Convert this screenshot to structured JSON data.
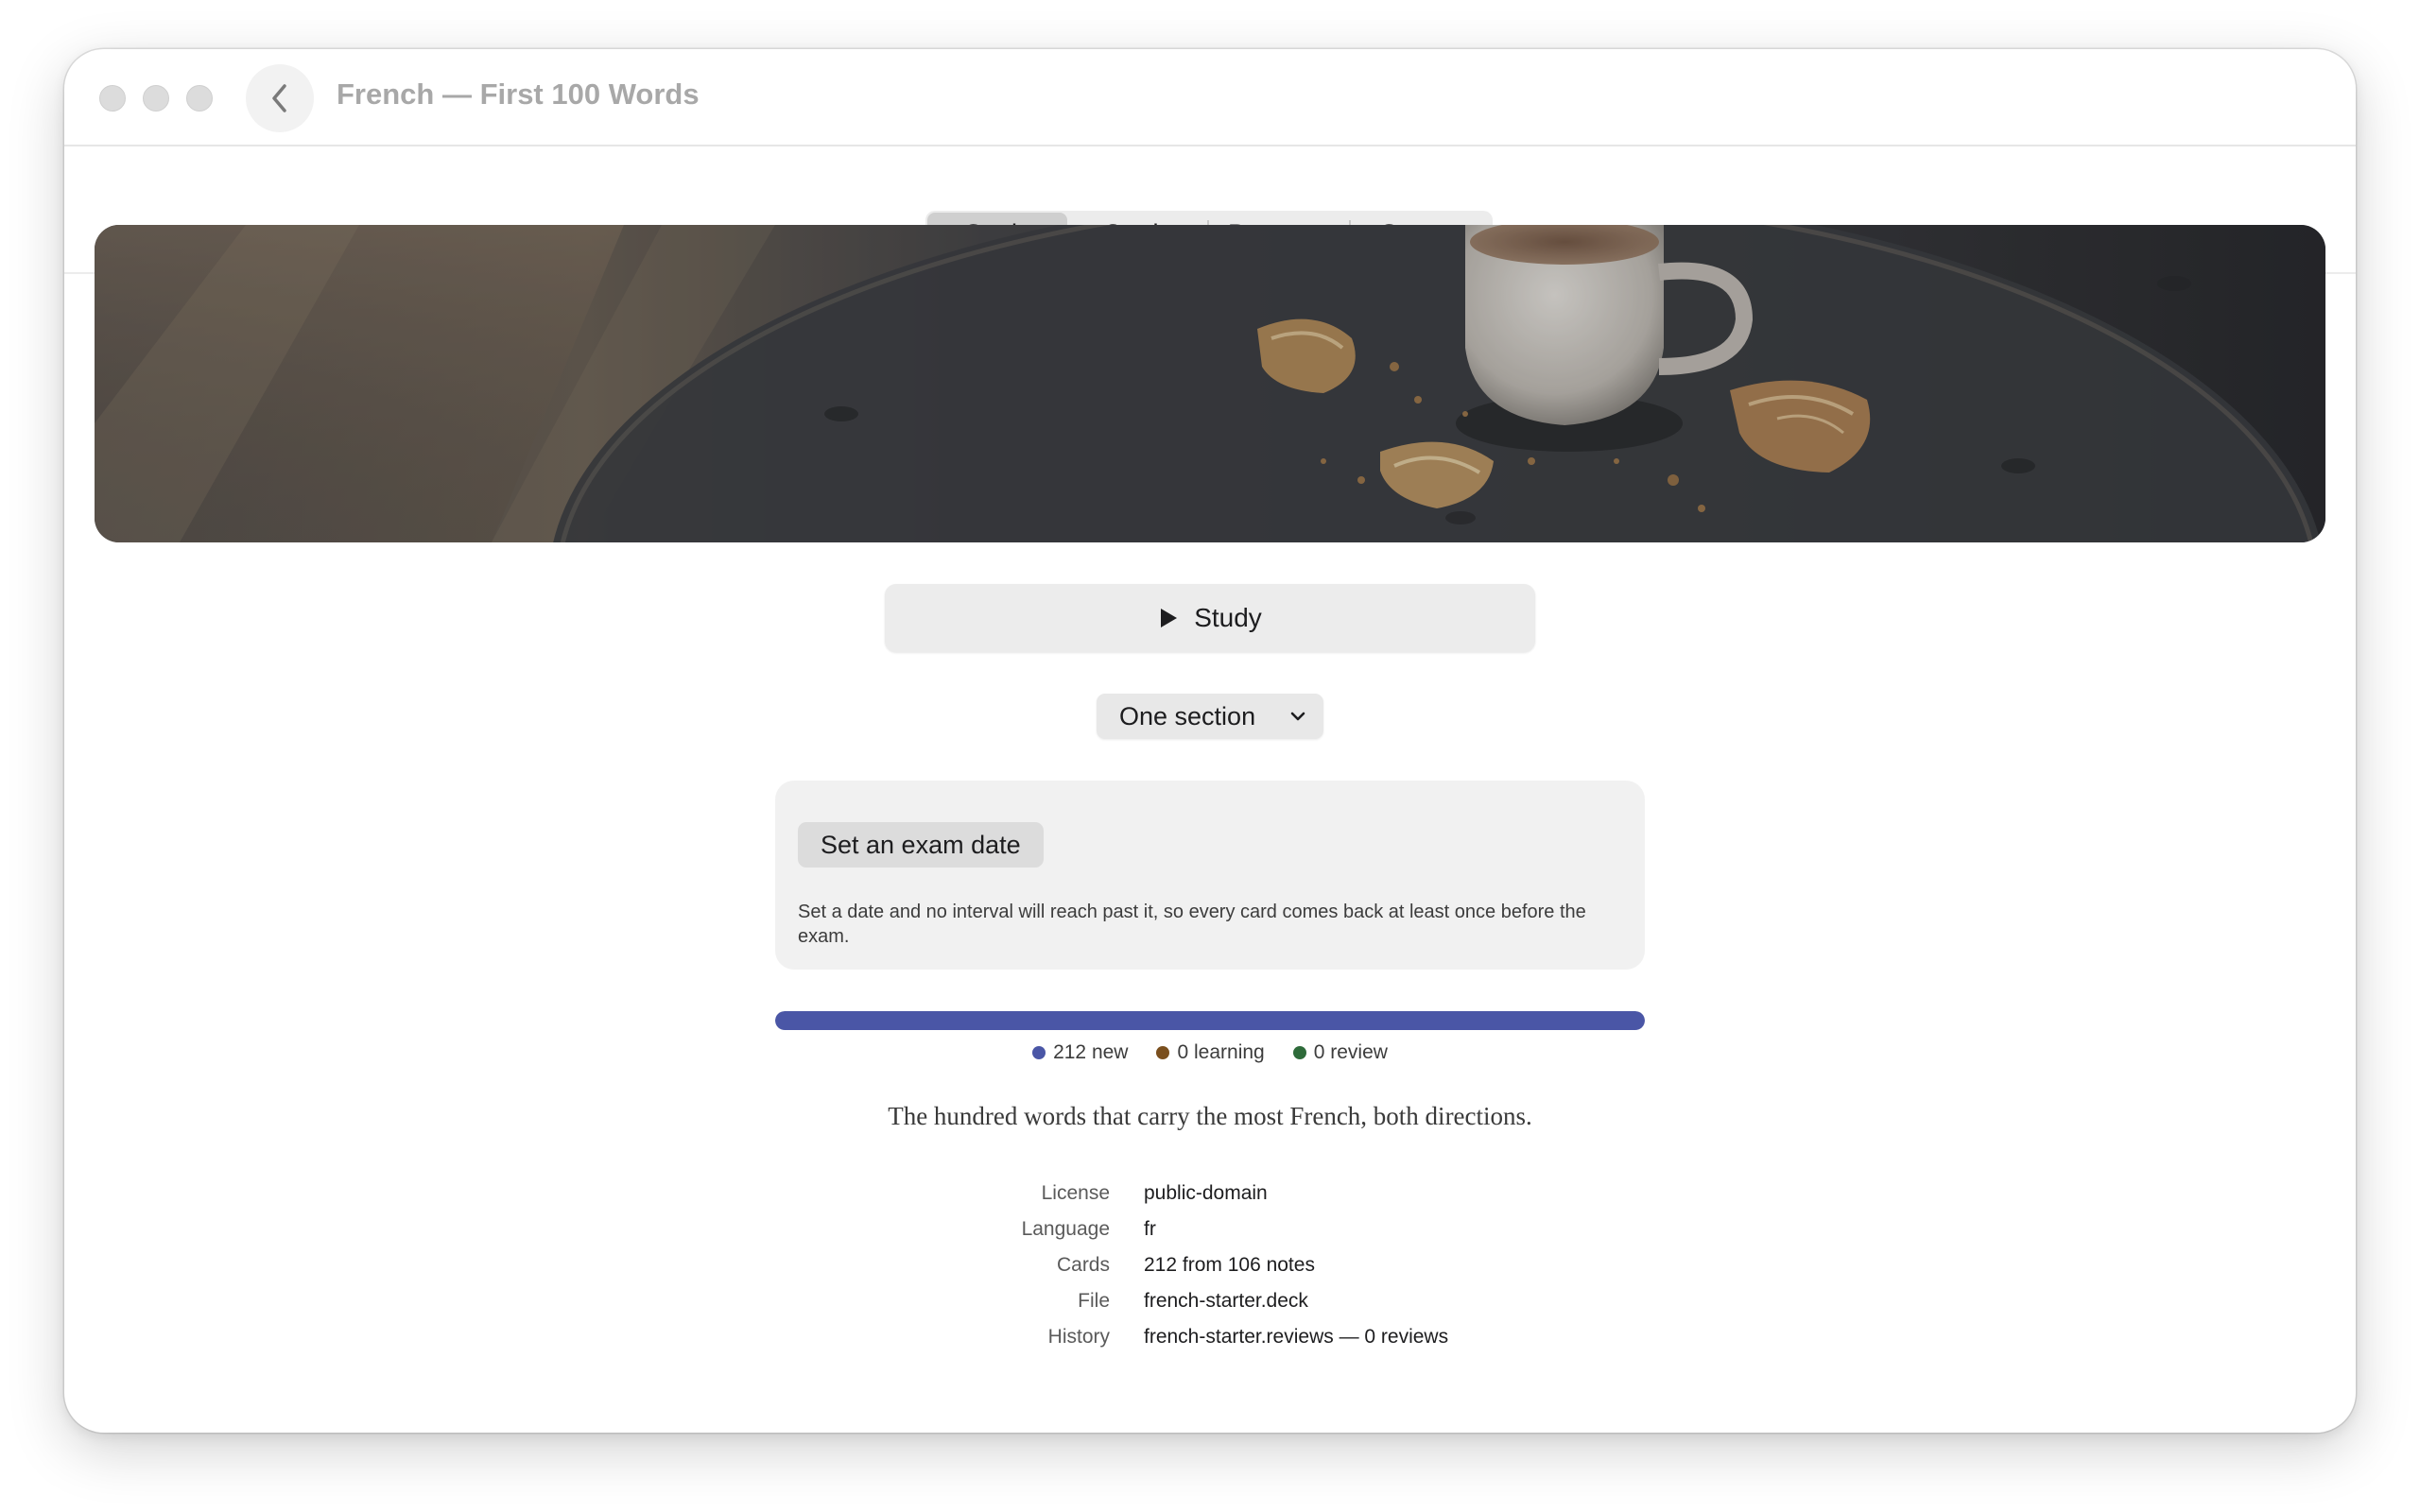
{
  "window": {
    "title": "French — First 100 Words"
  },
  "tabs": [
    {
      "label": "Study",
      "active": true
    },
    {
      "label": "Cards",
      "active": false
    },
    {
      "label": "Progress",
      "active": false
    },
    {
      "label": "Source",
      "active": false
    }
  ],
  "study_button": {
    "label": "Study",
    "icon": "play-icon"
  },
  "section_select": {
    "value": "One section",
    "icon": "chevron-down-icon"
  },
  "exam": {
    "button_label": "Set an exam date",
    "description": "Set a date and no interval will reach past it, so every card comes back at least once before the exam."
  },
  "progress": {
    "new_fraction": 1.0,
    "colors": {
      "new": "#4a56a6",
      "learning": "#7a4f1e",
      "review": "#2e6b3a"
    },
    "legend": {
      "new": "212 new",
      "learning": "0 learning",
      "review": "0 review"
    }
  },
  "deck": {
    "description": "The hundred words that carry the most French, both directions.",
    "meta": [
      {
        "key": "License",
        "value": "public-domain"
      },
      {
        "key": "Language",
        "value": "fr"
      },
      {
        "key": "Cards",
        "value": "212 from 106 notes"
      },
      {
        "key": "File",
        "value": "french-starter.deck"
      },
      {
        "key": "History",
        "value": "french-starter.reviews — 0 reviews"
      }
    ]
  }
}
